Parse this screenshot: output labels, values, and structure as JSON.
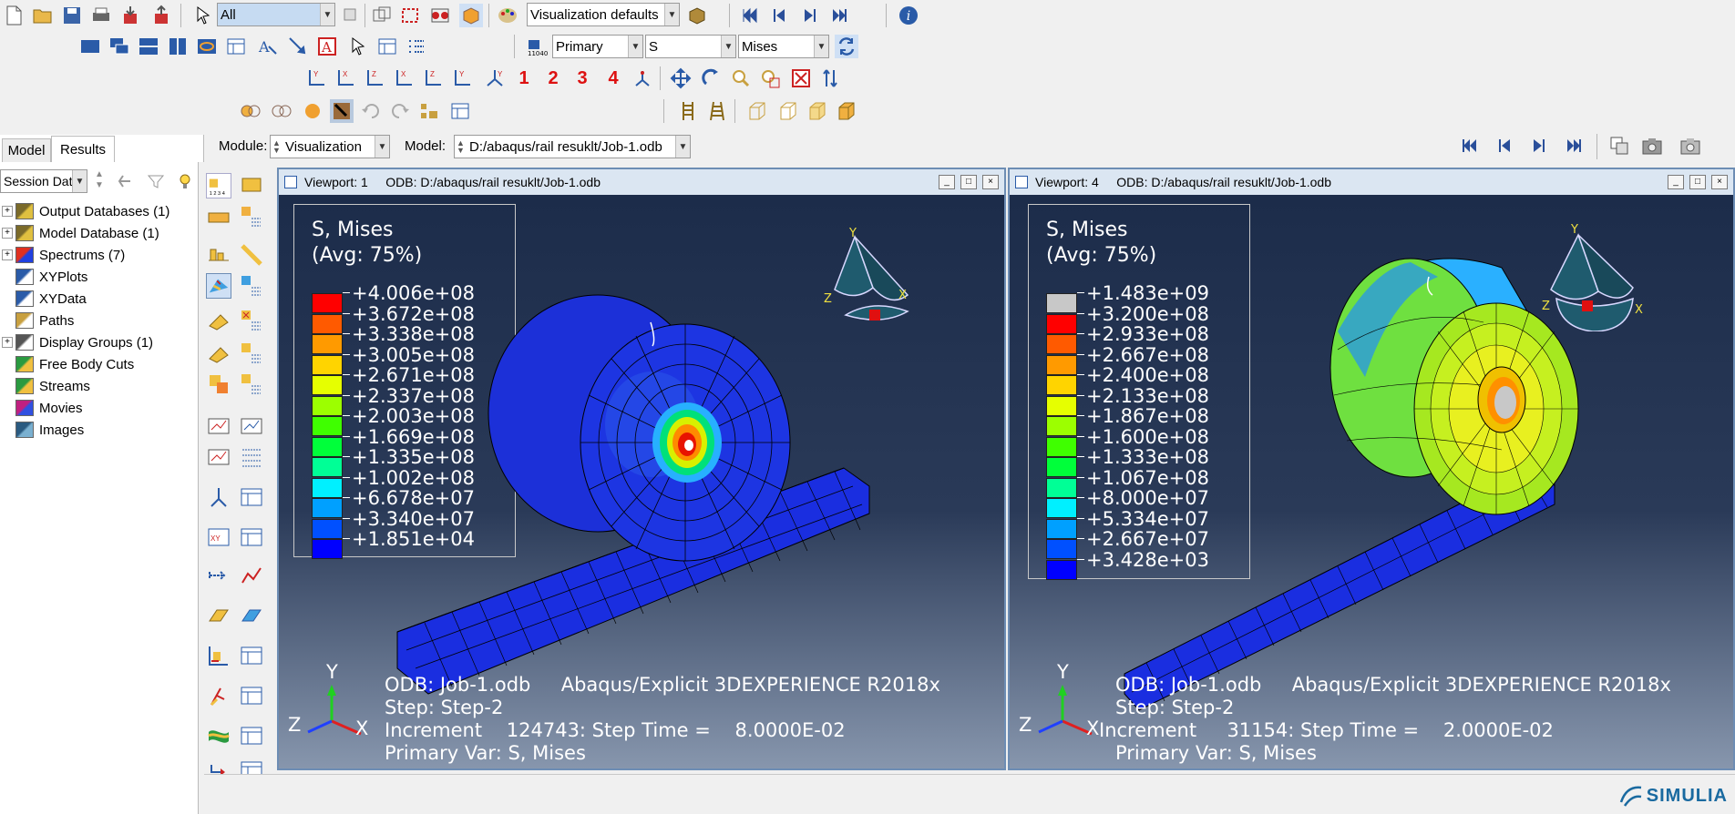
{
  "toolbar": {
    "selection_filter": "All",
    "view_defaults": "Visualization defaults",
    "field_position": "Primary",
    "field_variable": "S",
    "field_invariant": "Mises",
    "view_numbers": [
      "1",
      "2",
      "3",
      "4"
    ]
  },
  "context_bar": {
    "module_label": "Module:",
    "module_value": "Visualization",
    "model_label": "Model:",
    "model_value": "D:/abaqus/rail resuklt/Job-1.odb"
  },
  "tabs": [
    "Model",
    "Results"
  ],
  "tree": {
    "filter_value": "Session Data",
    "items": [
      {
        "label": "Output Databases (1)",
        "expandable": true,
        "icon": "database-icon"
      },
      {
        "label": "Model Database (1)",
        "expandable": true,
        "icon": "database-icon"
      },
      {
        "label": "Spectrums (7)",
        "expandable": true,
        "icon": "spectrum-icon"
      },
      {
        "label": "XYPlots",
        "expandable": false,
        "icon": "xyplot-icon"
      },
      {
        "label": "XYData",
        "expandable": false,
        "icon": "xydata-icon"
      },
      {
        "label": "Paths",
        "expandable": false,
        "icon": "path-icon"
      },
      {
        "label": "Display Groups (1)",
        "expandable": true,
        "icon": "display-group-icon"
      },
      {
        "label": "Free Body Cuts",
        "expandable": false,
        "icon": "free-body-icon"
      },
      {
        "label": "Streams",
        "expandable": false,
        "icon": "stream-icon"
      },
      {
        "label": "Movies",
        "expandable": false,
        "icon": "movie-icon"
      },
      {
        "label": "Images",
        "expandable": false,
        "icon": "image-icon"
      }
    ]
  },
  "viewports": [
    {
      "title": "Viewport: 1     ODB: D:/abaqus/rail resuklt/Job-1.odb",
      "legend_title_1": "S, Mises",
      "legend_title_2": "(Avg: 75%)",
      "legend_values": [
        "+4.006e+08",
        "+3.672e+08",
        "+3.338e+08",
        "+3.005e+08",
        "+2.671e+08",
        "+2.337e+08",
        "+2.003e+08",
        "+1.669e+08",
        "+1.335e+08",
        "+1.002e+08",
        "+6.678e+07",
        "+3.340e+07",
        "+1.851e+04"
      ],
      "legend_colors": [
        "#ff0000",
        "#ff5a00",
        "#ff9a00",
        "#ffd400",
        "#e6ff00",
        "#9cff00",
        "#3fff00",
        "#00ff3a",
        "#00ff96",
        "#00f0ff",
        "#00a0ff",
        "#0050ff",
        "#0000ff"
      ],
      "odb_line": "ODB: Job-1.odb     Abaqus/Explicit 3DEXPERIENCE R2018x",
      "step_line": "Step: Step-2",
      "increment_line": "Increment    124743: Step Time =    8.0000E-02",
      "primary_line": "Primary Var: S, Mises"
    },
    {
      "title": "Viewport: 4     ODB: D:/abaqus/rail resuklt/Job-1.odb",
      "legend_title_1": "S, Mises",
      "legend_title_2": "(Avg: 75%)",
      "legend_values": [
        "+1.483e+09",
        "+3.200e+08",
        "+2.933e+08",
        "+2.667e+08",
        "+2.400e+08",
        "+2.133e+08",
        "+1.867e+08",
        "+1.600e+08",
        "+1.333e+08",
        "+1.067e+08",
        "+8.000e+07",
        "+5.334e+07",
        "+2.667e+07",
        "+3.428e+03"
      ],
      "legend_colors": [
        "#c8c8c8",
        "#ff0000",
        "#ff5a00",
        "#ff9a00",
        "#ffd400",
        "#e6ff00",
        "#9cff00",
        "#3fff00",
        "#00ff3a",
        "#00ff96",
        "#00f0ff",
        "#00a0ff",
        "#0050ff",
        "#0000ff"
      ],
      "odb_line": "ODB: Job-1.odb     Abaqus/Explicit 3DEXPERIENCE R2018x",
      "step_line": "Step: Step-2",
      "increment_line": "Increment     31154: Step Time =    2.0000E-02",
      "primary_line": "Primary Var: S, Mises"
    }
  ],
  "triad_labels": {
    "x": "X",
    "y": "Y",
    "z": "Z"
  },
  "brand": "SIMULIA",
  "colors": {
    "mesh_blue": "#1d2fe0",
    "title_bar": "#dbe6f2",
    "accent": "#2a6cc8"
  }
}
